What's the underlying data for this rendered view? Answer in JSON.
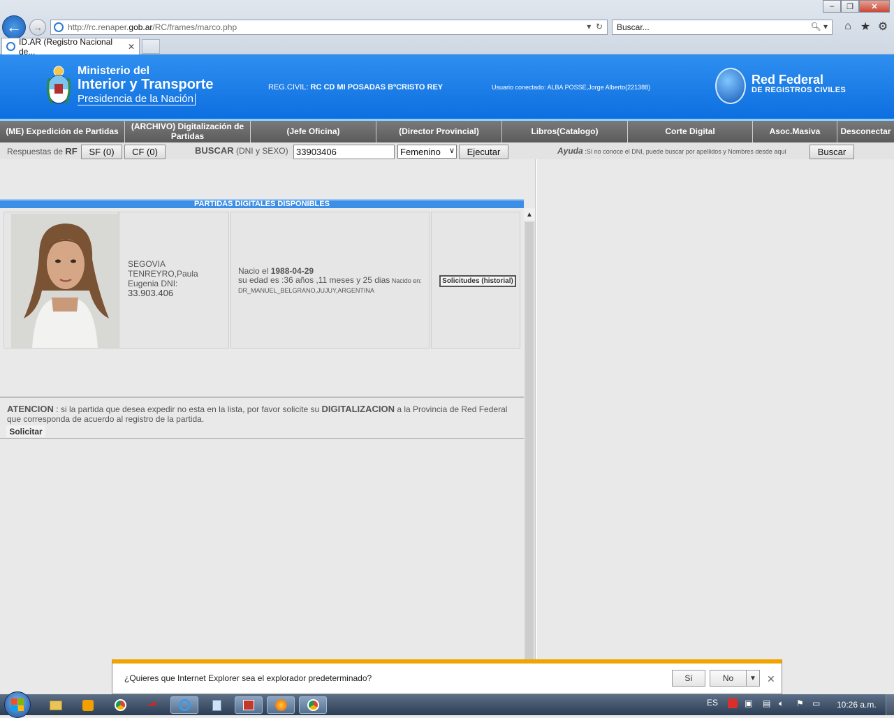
{
  "browser": {
    "url_prefix": "http://rc.renaper.",
    "url_host": "gob.ar",
    "url_path": "/RC/frames/marco.php",
    "search_placeholder": "Buscar...",
    "tab_title": "ID.AR (Registro Nacional de...",
    "win_minimize": "–",
    "win_restore": "❐",
    "win_close": "✕"
  },
  "banner": {
    "ministry_line1": "Ministerio del",
    "ministry_line2": "Interior y Transporte",
    "ministry_line3": "Presidencia de la Nación",
    "regcivil_label": "REG.CIVIL:",
    "regcivil_value": "RC CD MI POSADAS BºCRISTO REY",
    "usuario": "Usuario conectado: ALBA POSSE,Jorge Alberto(221388)",
    "rf_line1": "Red Federal",
    "rf_line2": "DE REGISTROS CIVILES"
  },
  "menu": [
    {
      "label": "(ME) Expedición de Partidas"
    },
    {
      "label": "(ARCHIVO) Digitalización de Partidas"
    },
    {
      "label": "(Jefe Oficina)"
    },
    {
      "label": "(Director Provincial)"
    },
    {
      "label": "Libros(Catalogo)"
    },
    {
      "label": "Corte Digital"
    },
    {
      "label": "Asoc.Masiva"
    },
    {
      "label": "Desconectar"
    }
  ],
  "search": {
    "respuestas_label": "Respuestas de ",
    "rf_bold": "RF",
    "sf_button": "SF (0)",
    "cf_button": "CF (0)",
    "buscar_bold": "BUSCAR",
    "buscar_hint": " (DNI y SEXO)",
    "dni_value": "33903406",
    "sexo_value": "Femenino",
    "ejecutar_button": "Ejecutar",
    "ayuda_bold": "Ayuda",
    "ayuda_text": " :Sí no conoce el DNI, puede buscar por apellidos y Nombres desde aquí",
    "buscar_button": "Buscar"
  },
  "results": {
    "section_title": "PARTIDAS DIGITALES DISPONIBLES",
    "person": {
      "name": "SEGOVIA TENREYRO,Paula Eugenia DNI:",
      "dni": "33.903.406",
      "nacio_label": "Nacio el ",
      "birth_date": "1988-04-29",
      "age": "su edad es :36 años ,11 meses y 25 dias",
      "nacido_label": " Nacido en:",
      "birthplace": "DR_MANUEL_BELGRANO,JUJUY,ARGENTINA",
      "historial_button": "Solicitudes (historial)"
    }
  },
  "atencion": {
    "title": "ATENCION",
    "text1": " : si la partida que desea expedir no esta en la lista, por favor solicite su ",
    "bold": "DIGITALIZACION",
    "text2": " a la Provincia de Red Federal que corresponda de acuerdo al registro de la partida.",
    "solicitar_button": "Solicitar"
  },
  "notification": {
    "text": "¿Quieres que Internet Explorer sea el explorador predeterminado?",
    "yes": "Sí",
    "no": "No"
  },
  "taskbar": {
    "language": "ES",
    "clock": "10:26 a.m."
  },
  "colors": {
    "banner_blue": "#1a7ae6",
    "menu_gray": "#666666",
    "notification_orange": "#f0a400"
  }
}
